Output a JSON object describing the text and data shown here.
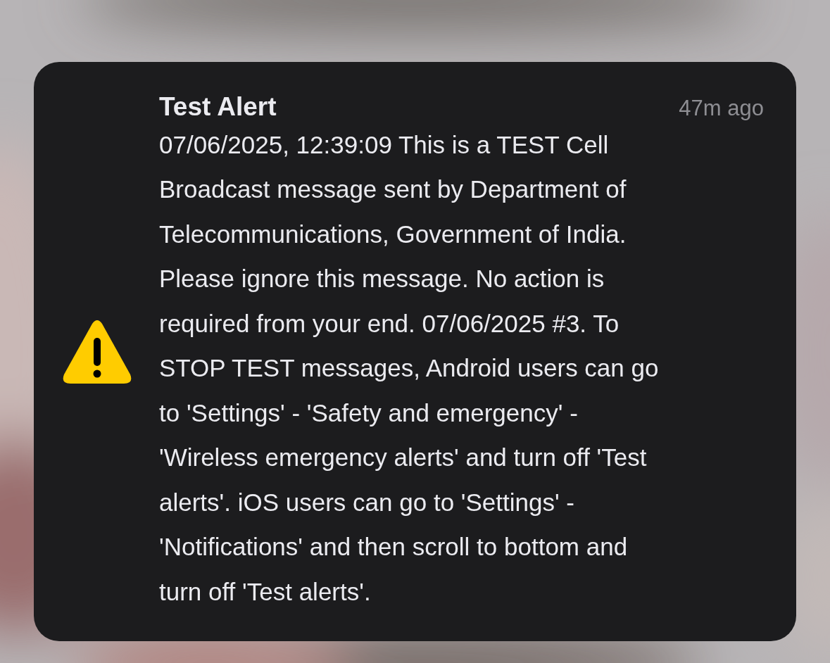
{
  "notification": {
    "title": "Test Alert",
    "time": "47m ago",
    "message_lines": [
      "07/06/2025, 12:39:09 This is a TEST Cell",
      "Broadcast message sent by Department of",
      "Telecommunications, Government of India.",
      "Please ignore this message. No action is",
      "required from your end. 07/06/2025 #3. To",
      "STOP TEST messages, Android users can go",
      "to 'Settings' - 'Safety and emergency' -",
      "'Wireless emergency alerts' and turn off 'Test",
      "alerts'. iOS users can go to 'Settings' -",
      "'Notifications' and then scroll to bottom and",
      "turn off 'Test alerts'."
    ]
  }
}
